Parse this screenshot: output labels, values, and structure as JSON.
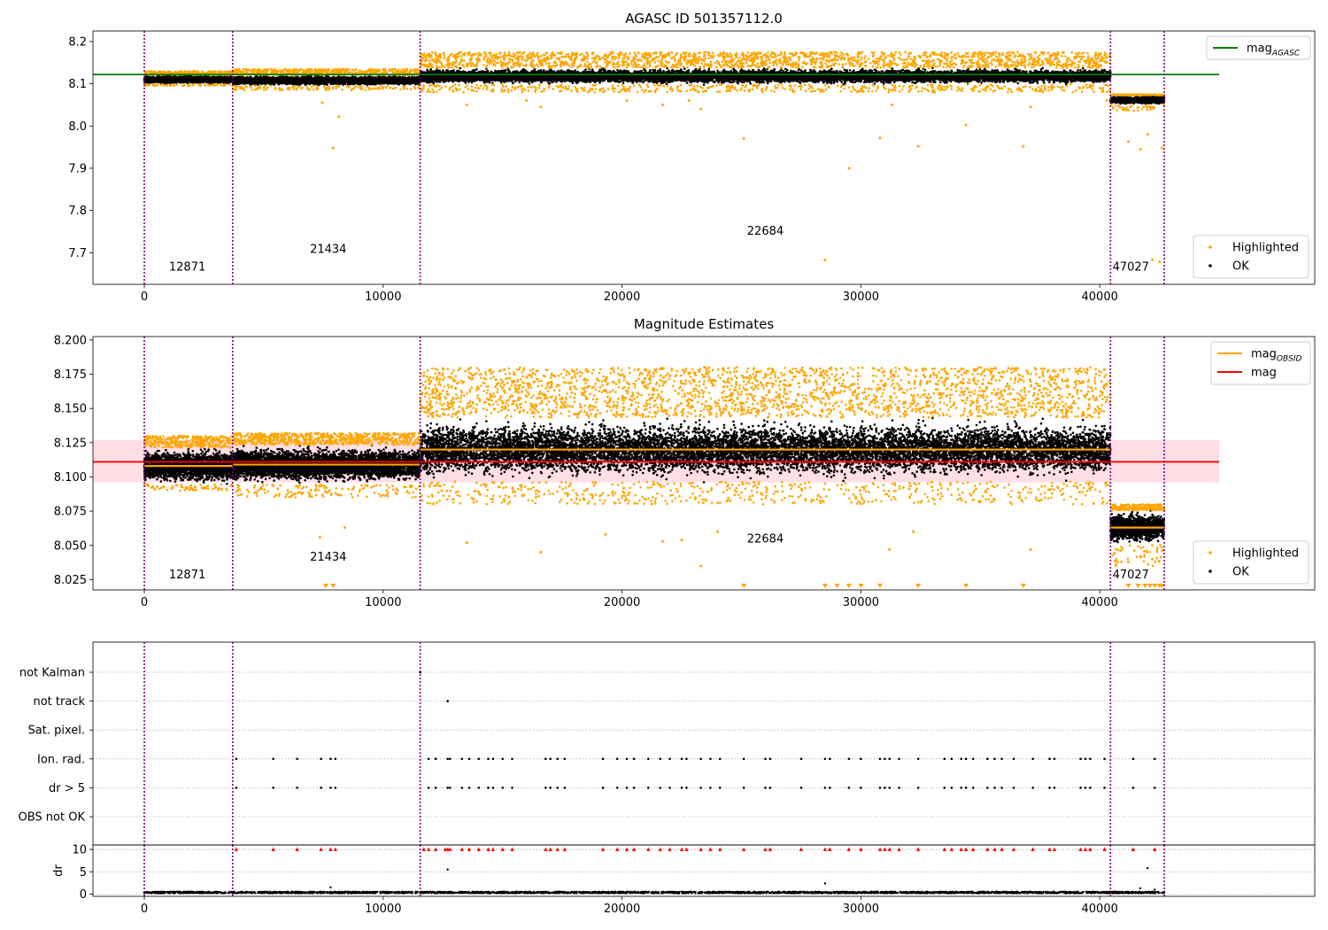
{
  "chart_data": [
    {
      "type": "scatter",
      "title": "AGASC ID 501357112.0",
      "xlabel": "",
      "ylabel": "",
      "xlim": [
        -2150,
        49000
      ],
      "ylim": [
        7.625,
        8.225
      ],
      "xticks": [
        0,
        10000,
        20000,
        30000,
        40000
      ],
      "yticks": [
        7.7,
        7.8,
        7.9,
        8.0,
        8.1,
        8.2
      ],
      "ytick_decimals": 1,
      "legend_lines": [
        {
          "label": "mag",
          "sub": "AGASC",
          "color": "#008000"
        }
      ],
      "legend_points": [
        {
          "label": "Highlighted",
          "color": "#ffa500"
        },
        {
          "label": "OK",
          "color": "#000000"
        }
      ],
      "hline": {
        "y": 8.122,
        "x0": -2150,
        "x1": 45000,
        "color": "#008000"
      },
      "obsid_boundaries": [
        0,
        3700,
        11550,
        40450,
        42700
      ],
      "obsid_labels": [
        {
          "x": 1800,
          "y": 7.658,
          "label": "12871"
        },
        {
          "x": 7700,
          "y": 7.7,
          "label": "21434"
        },
        {
          "x": 26000,
          "y": 7.742,
          "label": "22684"
        },
        {
          "x": 41300,
          "y": 7.658,
          "label": "47027"
        }
      ],
      "segments": [
        {
          "x0": 0,
          "x1": 3700,
          "center": 8.11,
          "halfwidth": 0.012,
          "outliers_up": 8.13,
          "outliers_down": 8.095
        },
        {
          "x0": 3700,
          "x1": 11550,
          "center": 8.108,
          "halfwidth": 0.014,
          "outliers_up": 8.135,
          "outliers_down": 8.085
        },
        {
          "x0": 11550,
          "x1": 40450,
          "center": 8.118,
          "halfwidth": 0.022,
          "outliers_up": 8.175,
          "outliers_down": 8.08
        },
        {
          "x0": 40450,
          "x1": 42700,
          "center": 8.062,
          "halfwidth": 0.012,
          "outliers_up": 8.075,
          "outliers_down": 8.035
        }
      ],
      "outliers": [
        [
          7450,
          8.055
        ],
        [
          7900,
          7.948
        ],
        [
          8150,
          8.022
        ],
        [
          13500,
          8.05
        ],
        [
          16000,
          8.06
        ],
        [
          16600,
          8.045
        ],
        [
          20200,
          8.06
        ],
        [
          21700,
          8.05
        ],
        [
          22800,
          8.06
        ],
        [
          23300,
          8.04
        ],
        [
          25100,
          7.97
        ],
        [
          28500,
          7.683
        ],
        [
          29500,
          7.9
        ],
        [
          30800,
          7.972
        ],
        [
          31300,
          8.05
        ],
        [
          32400,
          7.952
        ],
        [
          34400,
          8.002
        ],
        [
          36800,
          7.952
        ],
        [
          37100,
          8.045
        ],
        [
          40300,
          8.06
        ],
        [
          41200,
          7.963
        ],
        [
          41700,
          7.945
        ],
        [
          42000,
          7.98
        ],
        [
          42200,
          7.683
        ],
        [
          42500,
          7.678
        ],
        [
          42600,
          7.948
        ]
      ]
    },
    {
      "type": "scatter",
      "title": "Magnitude Estimates",
      "xlabel": "",
      "ylabel": "",
      "xlim": [
        -2150,
        49000
      ],
      "ylim": [
        8.0175,
        8.2025
      ],
      "xticks": [
        0,
        10000,
        20000,
        30000,
        40000
      ],
      "yticks": [
        8.025,
        8.05,
        8.075,
        8.1,
        8.125,
        8.15,
        8.175,
        8.2
      ],
      "ytick_decimals": 3,
      "legend_lines": [
        {
          "label": "mag",
          "sub": "OBSID",
          "color": "#ffa500"
        },
        {
          "label": "mag",
          "sub": "",
          "color": "#ff0000"
        }
      ],
      "legend_points": [
        {
          "label": "Highlighted",
          "color": "#ffa500"
        },
        {
          "label": "OK",
          "color": "#000000"
        }
      ],
      "hline": {
        "y": 8.111,
        "x0": -2150,
        "x1": 45000,
        "color": "#ff0000"
      },
      "band": {
        "y0": 8.096,
        "y1": 8.127,
        "x0": -2150,
        "x1": 45000,
        "color": "#ffc0cb"
      },
      "obsid_boundaries": [
        0,
        3700,
        11550,
        40450,
        42700
      ],
      "obsid_labels": [
        {
          "x": 1800,
          "y": 8.026,
          "label": "12871"
        },
        {
          "x": 7700,
          "y": 8.039,
          "label": "21434"
        },
        {
          "x": 26000,
          "y": 8.052,
          "label": "22684"
        },
        {
          "x": 41300,
          "y": 8.026,
          "label": "47027"
        }
      ],
      "obsid_means": [
        {
          "x0": 0,
          "x1": 3700,
          "y": 8.108
        },
        {
          "x0": 3700,
          "x1": 11550,
          "y": 8.109
        },
        {
          "x0": 11550,
          "x1": 40450,
          "y": 8.12
        },
        {
          "x0": 40450,
          "x1": 42700,
          "y": 8.063
        }
      ],
      "segments": [
        {
          "x0": 0,
          "x1": 3700,
          "center": 8.108,
          "halfwidth": 0.015,
          "outliers_up": 8.13,
          "outliers_down": 8.09
        },
        {
          "x0": 3700,
          "x1": 11550,
          "center": 8.109,
          "halfwidth": 0.016,
          "outliers_up": 8.132,
          "outliers_down": 8.085
        },
        {
          "x0": 11550,
          "x1": 40450,
          "center": 8.12,
          "halfwidth": 0.026,
          "outliers_up": 8.18,
          "outliers_down": 8.08
        },
        {
          "x0": 40450,
          "x1": 42700,
          "center": 8.063,
          "halfwidth": 0.014,
          "outliers_up": 8.08,
          "outliers_down": 8.035
        }
      ],
      "outliers": [
        [
          7350,
          8.056
        ],
        [
          8400,
          8.063
        ],
        [
          13500,
          8.052
        ],
        [
          16600,
          8.045
        ],
        [
          19300,
          8.058
        ],
        [
          21700,
          8.053
        ],
        [
          22500,
          8.054
        ],
        [
          23300,
          8.035
        ],
        [
          24000,
          8.06
        ],
        [
          31200,
          8.047
        ],
        [
          32200,
          8.06
        ],
        [
          37100,
          8.047
        ],
        [
          41200,
          8.038
        ],
        [
          41700,
          8.042
        ],
        [
          42200,
          8.04
        ]
      ],
      "clipped_low_x": [
        7600,
        7900,
        25100,
        28500,
        29000,
        29500,
        30000,
        30800,
        32400,
        34400,
        36800,
        41200,
        41600,
        41900,
        42100,
        42300,
        42500,
        42600
      ]
    },
    {
      "type": "scatter",
      "title": "",
      "xlabel": "",
      "ylabel": "",
      "xlim": [
        -2150,
        49000
      ],
      "xticks": [
        0,
        10000,
        20000,
        30000,
        40000
      ],
      "flag_categories": [
        "not Kalman",
        "not track",
        "Sat. pixel.",
        "Ion. rad.",
        "dr > 5",
        "OBS not OK"
      ],
      "obsid_boundaries": [
        0,
        3700,
        11550,
        40450,
        42700
      ],
      "flag_events": [
        {
          "flag": "not Kalman",
          "x": [
            11550
          ]
        },
        {
          "flag": "not track",
          "x": [
            12700
          ]
        },
        {
          "flag": "Ion. rad.",
          "x": [
            3850,
            5400,
            6400,
            7400,
            7800,
            8000,
            11900,
            12200,
            12700,
            12800,
            13300,
            13600,
            14000,
            14400,
            14600,
            15000,
            15400,
            16800,
            17000,
            17300,
            17600,
            19200,
            19800,
            20200,
            20500,
            21100,
            21600,
            22000,
            22500,
            22700,
            23300,
            23700,
            24100,
            25100,
            26000,
            26200,
            27500,
            28500,
            28700,
            29500,
            30000,
            30800,
            31000,
            31200,
            31600,
            32400,
            33500,
            33800,
            34200,
            34400,
            34700,
            35300,
            35600,
            35900,
            36400,
            37200,
            37900,
            38100,
            39200,
            39400,
            39600,
            40200,
            41400,
            42300
          ]
        },
        {
          "flag": "dr > 5",
          "x": [
            3850,
            5400,
            6400,
            7400,
            7800,
            8000,
            11900,
            12200,
            12700,
            12800,
            13300,
            13600,
            14000,
            14400,
            14600,
            15000,
            15400,
            16800,
            17000,
            17300,
            17600,
            19200,
            19800,
            20200,
            20500,
            21100,
            21600,
            22000,
            22500,
            22700,
            23300,
            23700,
            24100,
            25100,
            26000,
            26200,
            27500,
            28500,
            28700,
            29500,
            30000,
            30800,
            31000,
            31200,
            31600,
            32400,
            33500,
            33800,
            34200,
            34400,
            34700,
            35300,
            35600,
            35900,
            36400,
            37200,
            37900,
            38100,
            39200,
            39400,
            39600,
            40200,
            41400,
            42300
          ]
        }
      ]
    },
    {
      "type": "scatter",
      "title": "",
      "xlabel": "",
      "ylabel": "dr",
      "xlim": [
        -2150,
        49000
      ],
      "ylim": [
        -0.5,
        11
      ],
      "xticks": [
        0,
        10000,
        20000,
        30000,
        40000
      ],
      "yticks": [
        0,
        5,
        10
      ],
      "ytick_decimals": 0,
      "obsid_boundaries": [
        0,
        3700,
        11550,
        40450,
        42700
      ],
      "clip_value": 10,
      "clipped_x": [
        3850,
        5400,
        6400,
        7400,
        7800,
        8000,
        11700,
        11900,
        12200,
        12600,
        12700,
        12800,
        13300,
        13600,
        14000,
        14400,
        14600,
        15000,
        15400,
        16800,
        17000,
        17300,
        17600,
        19200,
        19800,
        20200,
        20500,
        21100,
        21600,
        22000,
        22500,
        22700,
        23300,
        23700,
        24100,
        25100,
        26000,
        26200,
        27500,
        28500,
        28700,
        29500,
        30000,
        30800,
        31000,
        31200,
        31600,
        32400,
        33500,
        33800,
        34200,
        34400,
        34700,
        35300,
        35600,
        35900,
        36400,
        37200,
        37900,
        38100,
        39200,
        39400,
        39600,
        40200,
        41400,
        42300
      ],
      "isolated_points": [
        [
          12700,
          5.5
        ],
        [
          42000,
          5.8
        ],
        [
          28500,
          2.4
        ],
        [
          7800,
          1.5
        ],
        [
          41700,
          1.3
        ],
        [
          42300,
          1.0
        ]
      ],
      "baseline": {
        "x0": 0,
        "x1": 42700,
        "y": 0.3,
        "spread": 0.35
      }
    }
  ]
}
